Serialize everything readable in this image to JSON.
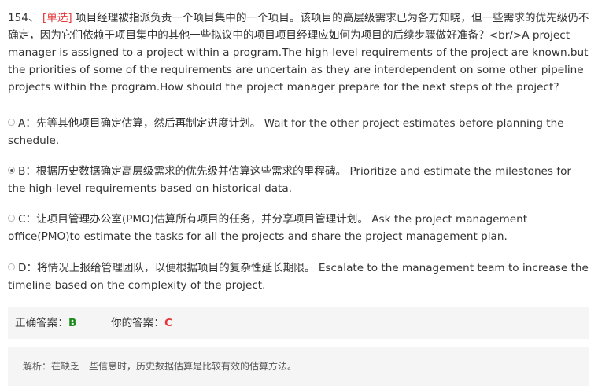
{
  "question": {
    "number": "154、",
    "type_tag": "[单选]",
    "text": "项目经理被指派负责一个项目集中的一个项目。该项目的高层级需求已为各方知晓，但一些需求的优先级仍不确定，因为它们依赖于项目集中的其他一些拟议中的项目项目经理应如何为项目的后续步骤做好准备？<br/>A project manager is assigned to a project within a program.The high-level requirements of the project are known.but the priorities of some of the requirements are uncertain as they are interdependent on some other pipeline projects within the program.How should the project manager prepare for the next steps of the project?"
  },
  "options": [
    {
      "label": "A：先等其他项目确定估算，然后再制定进度计划。 Wait for the other project estimates before planning the schedule.",
      "selected": false
    },
    {
      "label": "B：根据历史数据确定高层级需求的优先级并估算这些需求的里程碑。 Prioritize and estimate the milestones for the high-level requirements based on historical data.",
      "selected": true
    },
    {
      "label": "C：让项目管理办公室(PMO)估算所有项目的任务，并分享项目管理计划。 Ask the project management office(PMO)to estimate the tasks for all the projects and share the project management plan.",
      "selected": false
    },
    {
      "label": "D：将情况上报给管理团队，以便根据项目的复杂性延长期限。 Escalate to the management team to increase the timeline based on the complexity of the project.",
      "selected": false
    }
  ],
  "answer": {
    "correct_label": "正确答案：",
    "correct_value": "B",
    "yours_label": "你的答案：",
    "yours_value": "C"
  },
  "explanation": "解析：在缺乏一些信息时，历史数据估算是比较有效的估算方法。",
  "colors": {
    "question_type": "#e4393c",
    "correct": "#1a8a1a",
    "wrong": "#e4393c",
    "panel_bg": "#f5f5f5"
  }
}
